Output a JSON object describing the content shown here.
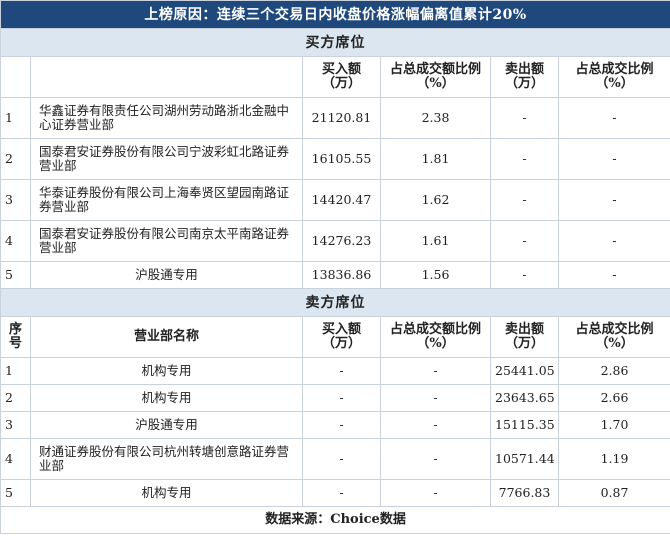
{
  "title": "上榜原因：连续三个交易日内收盘价格涨幅偏离值累计20%",
  "buy_section": {
    "label": "买方席位",
    "headers": [
      "",
      "",
      "买入额（万）",
      "占总成交额比例（%）",
      "卖出额（万）",
      "占总成交比例（%）"
    ],
    "rows": [
      {
        "rank": "1",
        "name": "华鑫证券有限责任公司湖州劳动路浙北金融中心证券营业部",
        "buy": "21120.81",
        "buy_pct": "2.38",
        "sell": "-",
        "sell_pct": "-"
      },
      {
        "rank": "2",
        "name": "国泰君安证券股份有限公司宁波彩虹北路证券营业部",
        "buy": "16105.55",
        "buy_pct": "1.81",
        "sell": "-",
        "sell_pct": "-"
      },
      {
        "rank": "3",
        "name": "华泰证券股份有限公司上海奉贤区望园南路证券营业部",
        "buy": "14420.47",
        "buy_pct": "1.62",
        "sell": "-",
        "sell_pct": "-"
      },
      {
        "rank": "4",
        "name": "国泰君安证券股份有限公司南京太平南路证券营业部",
        "buy": "14276.23",
        "buy_pct": "1.61",
        "sell": "-",
        "sell_pct": "-"
      },
      {
        "rank": "5",
        "name": "沪股通专用",
        "buy": "13836.86",
        "buy_pct": "1.56",
        "sell": "-",
        "sell_pct": "-"
      }
    ]
  },
  "sell_section": {
    "label": "卖方席位",
    "headers": [
      "序号",
      "营业部名称",
      "买入额（万）",
      "占总成交额比例（%）",
      "卖出额（万）",
      "占总成交比例（%）"
    ],
    "rows": [
      {
        "rank": "1",
        "name": "机构专用",
        "buy": "-",
        "buy_pct": "-",
        "sell": "25441.05",
        "sell_pct": "2.86"
      },
      {
        "rank": "2",
        "name": "机构专用",
        "buy": "-",
        "buy_pct": "-",
        "sell": "23643.65",
        "sell_pct": "2.66"
      },
      {
        "rank": "3",
        "name": "沪股通专用",
        "buy": "-",
        "buy_pct": "-",
        "sell": "15115.35",
        "sell_pct": "1.70"
      },
      {
        "rank": "4",
        "name": "财通证券股份有限公司杭州转塘创意路证券营业部",
        "buy": "-",
        "buy_pct": "-",
        "sell": "10571.44",
        "sell_pct": "1.19"
      },
      {
        "rank": "5",
        "name": "机构专用",
        "buy": "-",
        "buy_pct": "-",
        "sell": "7766.83",
        "sell_pct": "0.87"
      }
    ]
  },
  "footer": "数据来源：Choice数据"
}
